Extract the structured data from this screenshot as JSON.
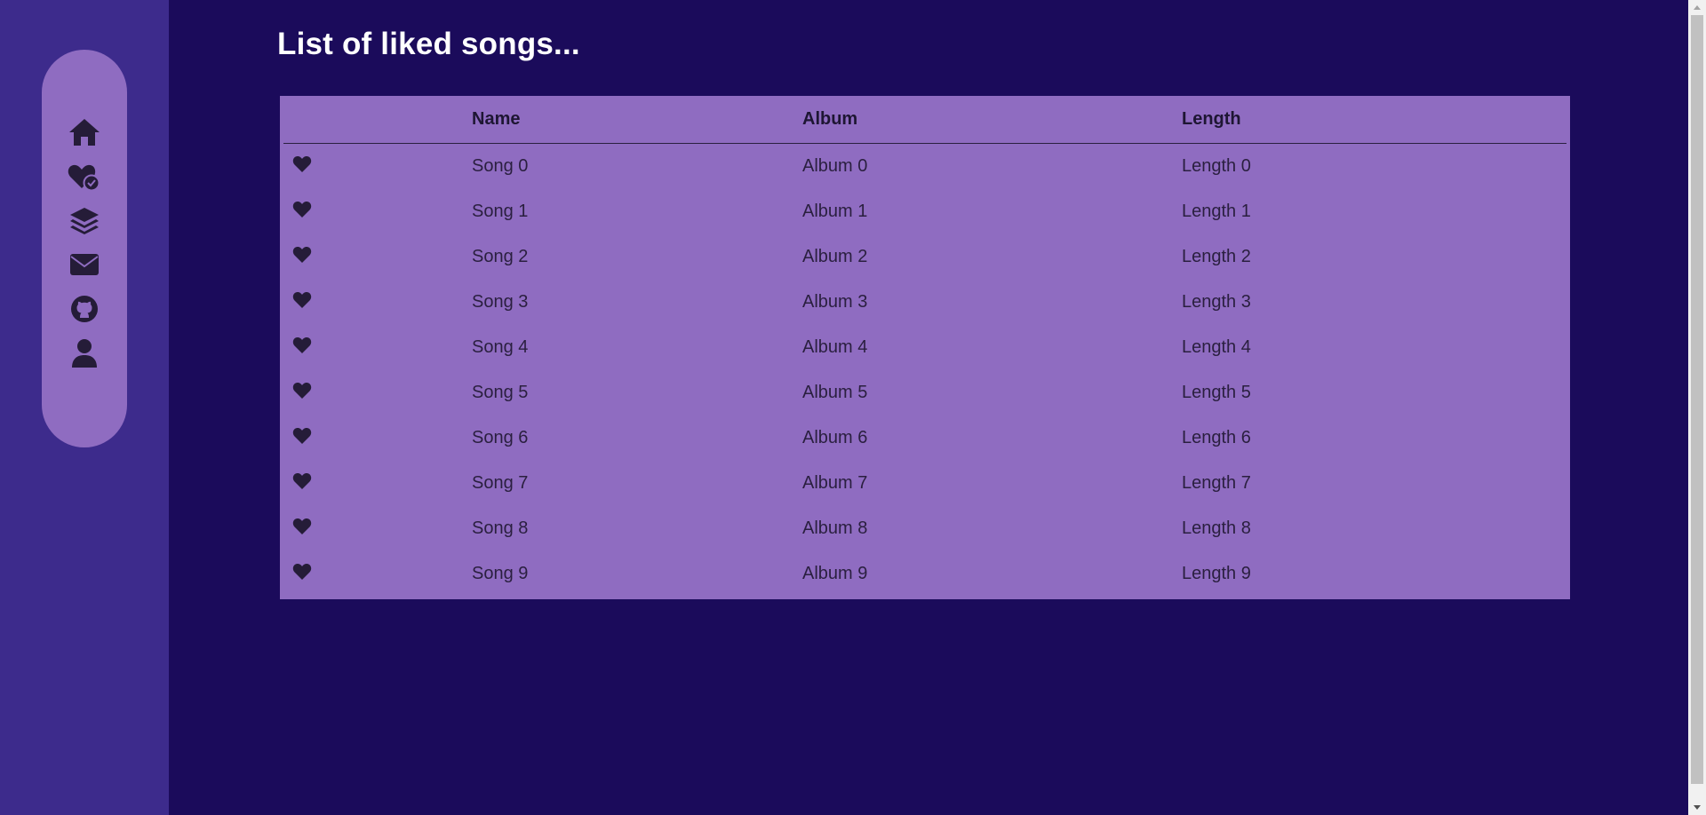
{
  "sidebar": {
    "nav_items": [
      {
        "icon": "home-icon"
      },
      {
        "icon": "liked-heart-check-icon"
      },
      {
        "icon": "layers-icon"
      },
      {
        "icon": "envelope-icon"
      },
      {
        "icon": "github-icon"
      },
      {
        "icon": "user-icon"
      }
    ]
  },
  "main": {
    "title": "List of liked songs...",
    "table": {
      "headers": [
        "",
        "Name",
        "Album",
        "Length"
      ],
      "rows": [
        {
          "name": "Song 0",
          "album": "Album 0",
          "length": "Length 0"
        },
        {
          "name": "Song 1",
          "album": "Album 1",
          "length": "Length 1"
        },
        {
          "name": "Song 2",
          "album": "Album 2",
          "length": "Length 2"
        },
        {
          "name": "Song 3",
          "album": "Album 3",
          "length": "Length 3"
        },
        {
          "name": "Song 4",
          "album": "Album 4",
          "length": "Length 4"
        },
        {
          "name": "Song 5",
          "album": "Album 5",
          "length": "Length 5"
        },
        {
          "name": "Song 6",
          "album": "Album 6",
          "length": "Length 6"
        },
        {
          "name": "Song 7",
          "album": "Album 7",
          "length": "Length 7"
        },
        {
          "name": "Song 8",
          "album": "Album 8",
          "length": "Length 8"
        },
        {
          "name": "Song 9",
          "album": "Album 9",
          "length": "Length 9"
        }
      ]
    }
  },
  "colors": {
    "page_bg": "#1b0b5b",
    "sidebar_bg": "#3d2b8c",
    "accent": "#8f6cc1",
    "text_dark": "#2a1f3f",
    "title_text": "#ffffff"
  }
}
